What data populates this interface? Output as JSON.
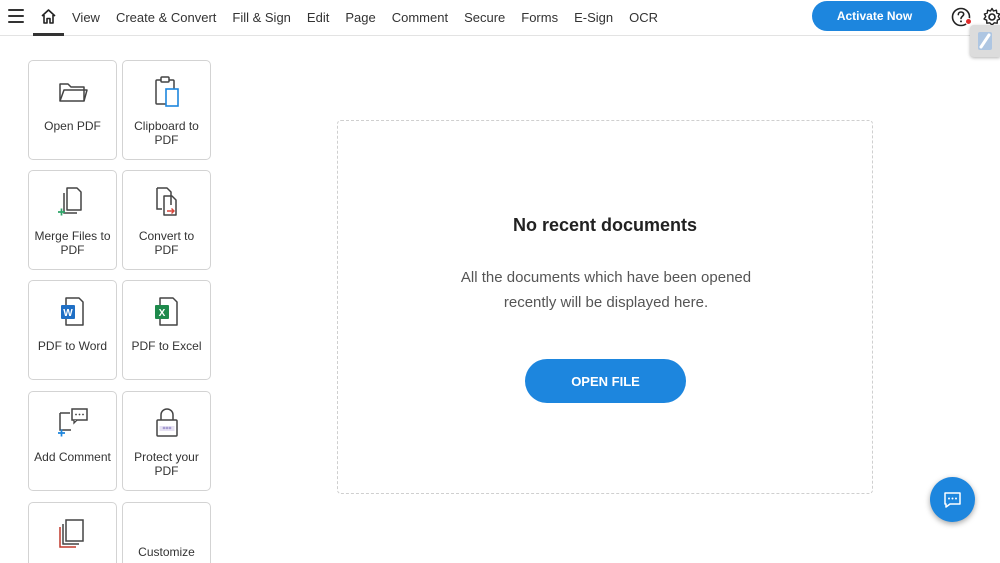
{
  "toolbar": {
    "menu": [
      "View",
      "Create & Convert",
      "Fill & Sign",
      "Edit",
      "Page",
      "Comment",
      "Secure",
      "Forms",
      "E-Sign",
      "OCR"
    ],
    "activate_label": "Activate Now"
  },
  "tools": [
    {
      "label": "Open PDF",
      "icon": "folder-icon"
    },
    {
      "label": "Clipboard to PDF",
      "icon": "clipboard-icon"
    },
    {
      "label": "Merge Files to PDF",
      "icon": "merge-files-icon"
    },
    {
      "label": "Convert to PDF",
      "icon": "convert-icon"
    },
    {
      "label": "PDF to Word",
      "icon": "word-icon"
    },
    {
      "label": "PDF to Excel",
      "icon": "excel-icon"
    },
    {
      "label": "Add Comment",
      "icon": "comment-icon"
    },
    {
      "label": "Protect your PDF",
      "icon": "lock-icon"
    },
    {
      "label": "",
      "icon": "pages-icon"
    },
    {
      "label": "Customize",
      "icon": ""
    }
  ],
  "empty_state": {
    "title": "No recent documents",
    "description": "All the documents which have been opened recently will be displayed here.",
    "button": "OPEN FILE"
  },
  "colors": {
    "accent": "#1d86de",
    "word": "#1f6fc5",
    "excel": "#1e8a4c",
    "plus": "#2fa56a"
  }
}
